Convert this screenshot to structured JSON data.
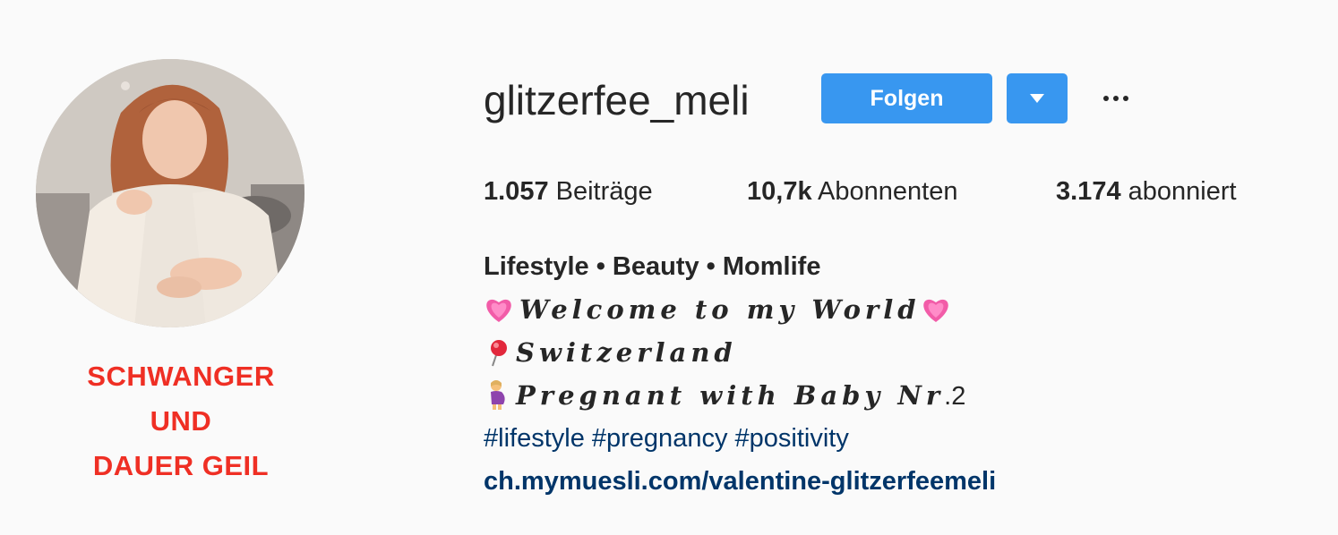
{
  "profile": {
    "username": "glitzerfee_meli",
    "follow_label": "Folgen",
    "dropdown_icon": "triangle-down-icon",
    "more_icon": "ellipsis-icon",
    "accent_color": "#3897f0"
  },
  "avatar": {
    "caption_lines": [
      "SCHWANGER",
      "UND",
      "DAUER GEIL"
    ],
    "caption_color": "#ef2f24"
  },
  "stats": [
    {
      "count": "1.057",
      "label": "Beiträge"
    },
    {
      "count": "10,7k",
      "label": "Abonnenten"
    },
    {
      "count": "3.174",
      "label": "abonniert"
    }
  ],
  "bio": {
    "name": "Lifestyle • Beauty • Momlife",
    "line1": {
      "icon": "pink-heart-icon",
      "text": "Welcome to my World",
      "trail_icon": "pink-heart-icon"
    },
    "line2": {
      "icon": "round-pushpin-icon",
      "text": "Switzerland"
    },
    "line3": {
      "icon": "pregnant-woman-icon",
      "text": "Pregnant with Baby Nr",
      "suffix": ".2"
    },
    "hashtags": [
      "#lifestyle",
      "#pregnancy",
      "#positivity"
    ],
    "link": "ch.mymuesli.com/valentine-glitzerfeemeli",
    "link_color": "#003569"
  }
}
